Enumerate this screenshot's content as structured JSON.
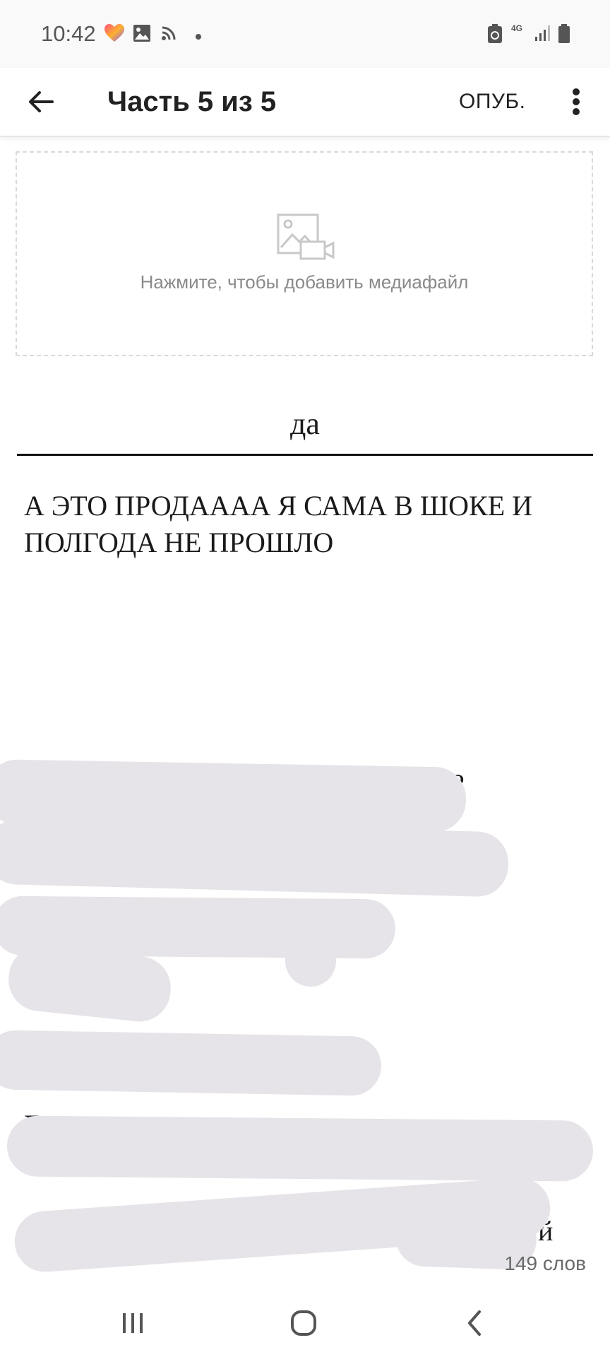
{
  "status_bar": {
    "time": "10:42",
    "network": "4G",
    "icons": [
      "heart-app-icon",
      "gallery-icon",
      "cast-icon",
      "dot-icon",
      "battery-saver-icon",
      "signal-icon",
      "battery-icon"
    ]
  },
  "toolbar": {
    "title": "Часть 5 из 5",
    "publish_label": "ОПУБ.",
    "back_icon": "arrow-left-icon",
    "more_icon": "more-vert-icon"
  },
  "media": {
    "hint": "Нажмите, чтобы добавить медиафайл",
    "icon": "image-video-icon"
  },
  "part": {
    "title": "да",
    "body": "А ЭТО ПРОДАААА Я САМА В ШОКЕ И ПОЛГОДА НЕ ПРОШЛО"
  },
  "visible_fragments": {
    "f1": "?",
    "f2": "Б",
    "f3": "?",
    "f4": "Е",
    "f5": "й"
  },
  "word_count": "149 слов",
  "nav_bar": {
    "icons": [
      "recent-apps-icon",
      "home-icon",
      "back-icon"
    ]
  },
  "colors": {
    "redaction": "#e6e4e8",
    "divider": "#111111"
  }
}
